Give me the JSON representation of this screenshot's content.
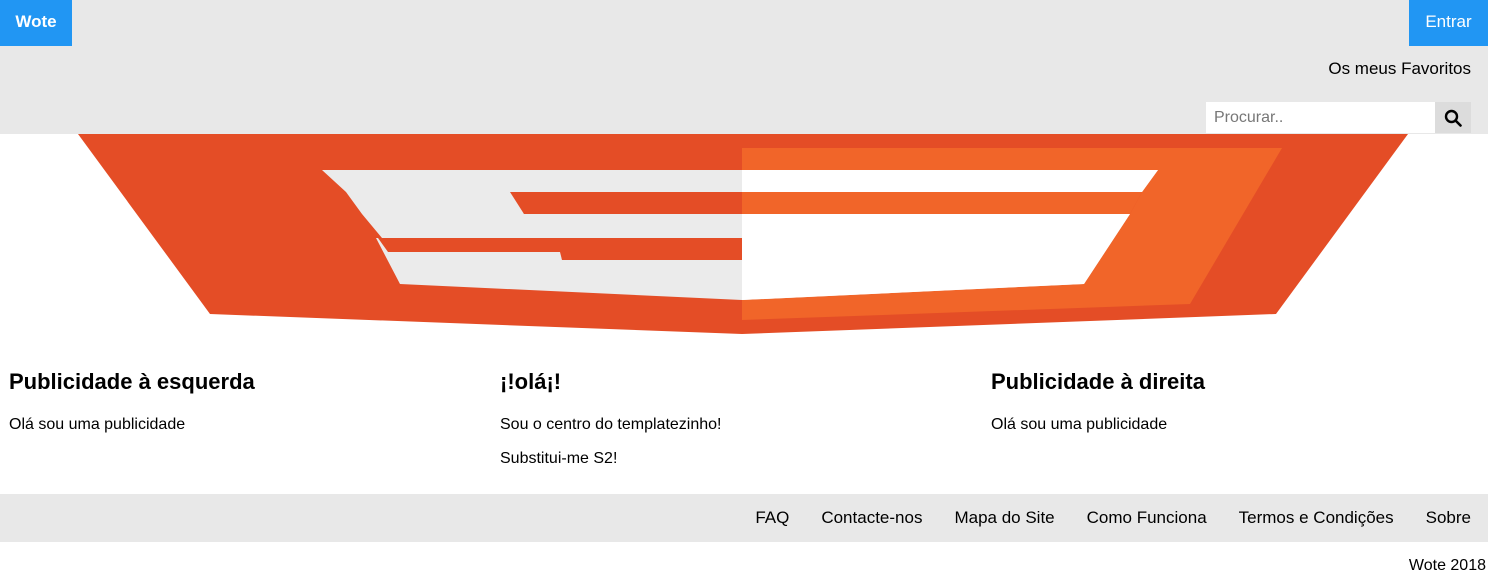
{
  "header": {
    "brand": "Wote",
    "login_label": "Entrar",
    "favorites_label": "Os meus Favoritos",
    "search": {
      "placeholder": "Procurar..",
      "value": "",
      "icon": "search-icon"
    }
  },
  "banner": {
    "logo_icon": "s2-logo",
    "colors": {
      "dark_orange": "#e44d26",
      "light_orange": "#f16529",
      "white": "#ebebeb"
    }
  },
  "columns": [
    {
      "title": "Publicidade à esquerda",
      "lines": [
        "Olá sou uma publicidade"
      ]
    },
    {
      "title": "¡!olá¡!",
      "lines": [
        "Sou o centro do templatezinho!",
        "Substitui-me S2!"
      ]
    },
    {
      "title": "Publicidade à direita",
      "lines": [
        "Olá sou uma publicidade"
      ]
    }
  ],
  "footer": {
    "links": [
      "FAQ",
      "Contacte-nos",
      "Mapa do Site",
      "Como Funciona",
      "Termos e Condições",
      "Sobre"
    ],
    "copyright": "Wote 2018"
  },
  "colors": {
    "accent": "#2196f3",
    "bar_background": "#e8e8e8"
  }
}
